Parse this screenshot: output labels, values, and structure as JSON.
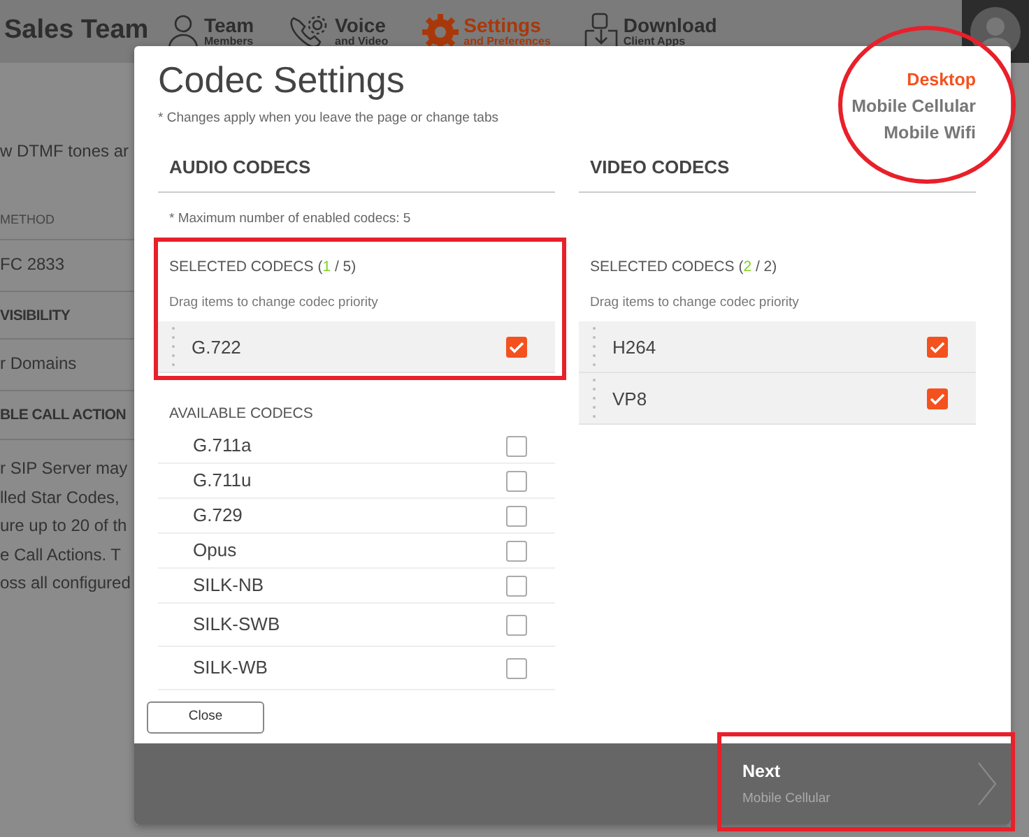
{
  "header": {
    "team_name": "Sales Team",
    "nav": [
      {
        "label": "Team",
        "sublabel": "Members",
        "selected": false
      },
      {
        "label": "Voice",
        "sublabel": "and Video",
        "selected": false
      },
      {
        "label": "Settings",
        "sublabel": "and Preferences",
        "selected": true
      },
      {
        "label": "Download",
        "sublabel": "Client Apps",
        "selected": false
      }
    ]
  },
  "background_page": {
    "lines": [
      {
        "kind": "text",
        "text": "w DTMF tones ar"
      },
      {
        "kind": "label",
        "text": "METHOD"
      },
      {
        "kind": "value",
        "text": "FC 2833"
      },
      {
        "kind": "heading",
        "text": "VISIBILITY"
      },
      {
        "kind": "value",
        "text": "r Domains"
      },
      {
        "kind": "heading",
        "text": "BLE CALL ACTION"
      },
      {
        "kind": "paragraph",
        "text": "r SIP Server may"
      },
      {
        "kind": "paragraph",
        "text": "lled Star Codes,"
      },
      {
        "kind": "paragraph",
        "text": "ure up to 20 of th"
      },
      {
        "kind": "paragraph",
        "text": "e Call Actions. T"
      },
      {
        "kind": "paragraph",
        "text": "oss all configured"
      }
    ]
  },
  "modal": {
    "title": "Codec Settings",
    "note": "* Changes apply when you leave the page or change tabs",
    "device_tabs": [
      {
        "label": "Desktop",
        "selected": true
      },
      {
        "label": "Mobile Cellular",
        "selected": false
      },
      {
        "label": "Mobile Wifi",
        "selected": false
      }
    ],
    "audio": {
      "heading": "AUDIO CODECS",
      "max_note": "* Maximum number of enabled codecs: 5",
      "selected_label": {
        "prefix": "SELECTED CODECS (",
        "count": "1",
        "suffix": " / 5)"
      },
      "hint": "Drag items to change codec priority",
      "selected_codecs": [
        {
          "name": "G.722",
          "checked": true
        }
      ],
      "available_heading": "AVAILABLE CODECS",
      "available_codecs": [
        {
          "name": "G.711a",
          "checked": false
        },
        {
          "name": "G.711u",
          "checked": false
        },
        {
          "name": "G.729",
          "checked": false
        },
        {
          "name": "Opus",
          "checked": false
        },
        {
          "name": "SILK-NB",
          "checked": false
        },
        {
          "name": "SILK-SWB",
          "checked": false
        },
        {
          "name": "SILK-WB",
          "checked": false
        }
      ]
    },
    "video": {
      "heading": "VIDEO CODECS",
      "selected_label": {
        "prefix": "SELECTED CODECS (",
        "count": "2",
        "suffix": " / 2)"
      },
      "hint": "Drag items to change codec priority",
      "selected_codecs": [
        {
          "name": "H264",
          "checked": true
        },
        {
          "name": "VP8",
          "checked": true
        }
      ]
    },
    "close_button": "Close",
    "footer": {
      "next_label": "Next",
      "next_sublabel": "Mobile Cellular"
    }
  }
}
